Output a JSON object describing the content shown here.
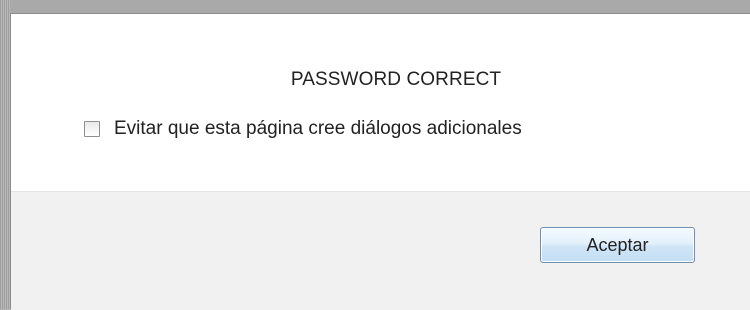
{
  "dialog": {
    "message": "PASSWORD CORRECT",
    "checkbox_label": "Evitar que esta página cree diálogos adicionales",
    "checkbox_checked": false,
    "accept_label": "Aceptar"
  },
  "colors": {
    "dialog_background": "#ffffff",
    "footer_background": "#f1f1f1",
    "button_border": "#6f8fb0",
    "button_fill": "#d6e9f8"
  }
}
